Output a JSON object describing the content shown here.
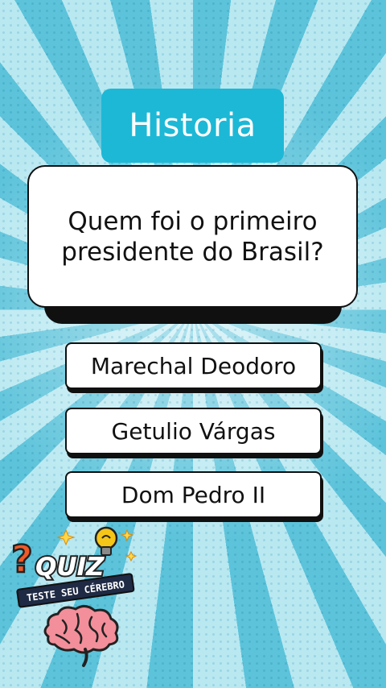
{
  "category": {
    "label": "Historia"
  },
  "question": {
    "text": "Quem foi o primeiro presidente do Brasil?"
  },
  "answers": [
    {
      "label": "Marechal Deodoro"
    },
    {
      "label": "Getulio Várgas"
    },
    {
      "label": "Dom Pedro II"
    }
  ],
  "logo": {
    "title": "QUIZ",
    "subtitle": "TESTE SEU CÉREBRO"
  },
  "colors": {
    "category_bg": "#1db8d6",
    "background_light": "#b9e8f1",
    "background_ray": "#5cc3da",
    "brain": "#f28f9a",
    "accent_orange": "#f05a28",
    "bulb": "#f5c518"
  }
}
